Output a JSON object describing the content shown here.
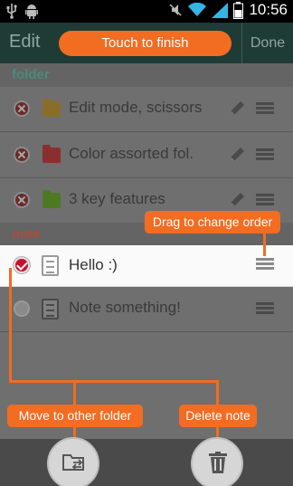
{
  "status_bar": {
    "time": "10:56",
    "icons": [
      "usb-icon",
      "android-icon",
      "mute-icon",
      "wifi-icon",
      "signal-icon",
      "battery-icon"
    ]
  },
  "action_bar": {
    "title": "Edit",
    "finish_label": "Touch to finish",
    "done_label": "Done"
  },
  "folders": {
    "header": "folder",
    "items": [
      {
        "label": "Edit mode, scissors",
        "color": "#8a6d2a"
      },
      {
        "label": "Color assorted fol.",
        "color": "#8a2f2f"
      },
      {
        "label": "3 key features",
        "color": "#4c7a22"
      }
    ]
  },
  "notes": {
    "header": "note",
    "items": [
      {
        "label": "Hello :)",
        "checked": true
      },
      {
        "label": "Note something!",
        "checked": false
      }
    ]
  },
  "callouts": {
    "drag": "Drag to change order",
    "move": "Move to other folder",
    "delete": "Delete note"
  },
  "bottom_bar": {
    "buttons": [
      "move-folder-icon",
      "trash-icon"
    ]
  },
  "colors": {
    "accent": "#f26c22",
    "action_bar": "#1f3b36",
    "checked": "#c8102e"
  }
}
